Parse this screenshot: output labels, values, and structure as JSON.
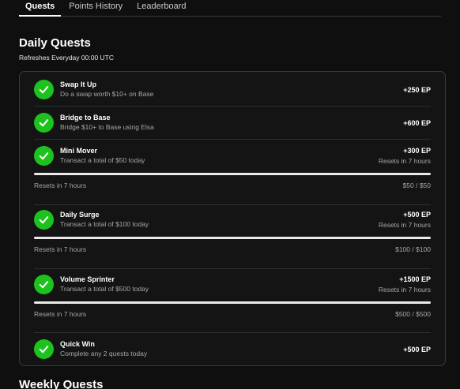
{
  "tabs": [
    {
      "label": "Quests",
      "active": true
    },
    {
      "label": "Points History",
      "active": false
    },
    {
      "label": "Leaderboard",
      "active": false
    }
  ],
  "daily": {
    "title": "Daily Quests",
    "subtitle": "Refreshes Everyday 00:00 UTC",
    "quests": [
      {
        "name": "Swap It Up",
        "desc": "Do a swap worth $10+ on Base",
        "points": "+250 EP",
        "completed": true
      },
      {
        "name": "Bridge to Base",
        "desc": "Bridge $10+ to Base using Elsa",
        "points": "+600 EP",
        "completed": true
      },
      {
        "name": "Mini Mover",
        "desc": "Transact a total of $50 today",
        "points": "+300 EP",
        "completed": true,
        "reset_right": "Resets in 7 hours",
        "reset_left": "Resets in 7 hours",
        "progress_text": "$50 / $50",
        "progress": 1.0
      },
      {
        "name": "Daily Surge",
        "desc": "Transact a total of $100 today",
        "points": "+500 EP",
        "completed": true,
        "reset_right": "Resets in 7 hours",
        "reset_left": "Resets in 7 hours",
        "progress_text": "$100 / $100",
        "progress": 1.0
      },
      {
        "name": "Volume Sprinter",
        "desc": "Transact a total of $500 today",
        "points": "+1500 EP",
        "completed": true,
        "reset_right": "Resets in 7 hours",
        "reset_left": "Resets in 7 hours",
        "progress_text": "$500 / $500",
        "progress": 1.0
      },
      {
        "name": "Quick Win",
        "desc": "Complete any 2 quests today",
        "points": "+500 EP",
        "completed": true
      }
    ]
  },
  "weekly": {
    "title": "Weekly Quests"
  },
  "icons": {
    "check": "check-icon"
  },
  "colors": {
    "check_green": "#1ec21e",
    "background": "#0f0f10"
  }
}
